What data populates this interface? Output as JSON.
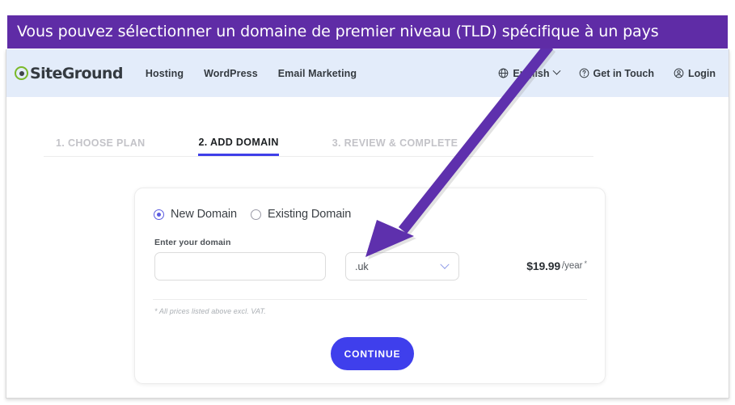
{
  "annotation": {
    "banner_text": "Vous pouvez sélectionner un domaine de premier niveau (TLD) spécifique à un pays",
    "banner_color": "#5f2ca6",
    "arrow_color": "#5e30ad",
    "arrow_points_to": ".uk TLD dropdown"
  },
  "header": {
    "logo_text": "SiteGround",
    "logo_icon": "siteground-g-icon",
    "logo_accent_color": "#7ab929",
    "nav_left": [
      {
        "label": "Hosting"
      },
      {
        "label": "WordPress"
      },
      {
        "label": "Email Marketing"
      }
    ],
    "nav_right": [
      {
        "label": "English",
        "icon": "globe-icon",
        "has_chevron": true
      },
      {
        "label": "Get in Touch",
        "icon": "question-circle-icon",
        "has_chevron": false
      },
      {
        "label": "Login",
        "icon": "user-circle-icon",
        "has_chevron": false
      }
    ],
    "background_color": "#e3ecfa"
  },
  "steps": [
    {
      "label": "1. CHOOSE PLAN",
      "active": false
    },
    {
      "label": "2. ADD DOMAIN",
      "active": true
    },
    {
      "label": "3. REVIEW & COMPLETE",
      "active": false
    }
  ],
  "steps_active_color": "#3f3fe8",
  "card": {
    "radio_options": [
      {
        "label": "New Domain",
        "selected": true
      },
      {
        "label": "Existing Domain",
        "selected": false
      }
    ],
    "domain_field": {
      "label": "Enter your domain",
      "value": "",
      "placeholder": ""
    },
    "tld_select": {
      "value": ".uk",
      "chevron_icon": "chevron-down-icon"
    },
    "price": {
      "amount": "$19.99",
      "period": "/year",
      "asterisk": "*"
    },
    "footnote": "* All prices listed above excl. VAT.",
    "continue_label": "CONTINUE",
    "continue_color": "#3f3fec"
  }
}
